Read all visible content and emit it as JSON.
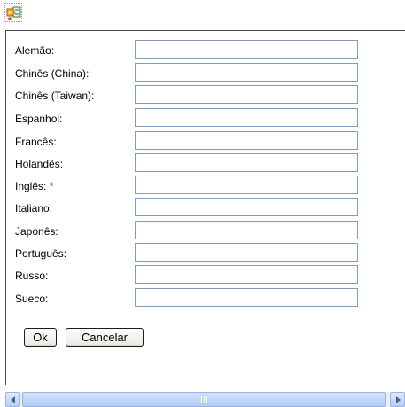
{
  "toolbar": {
    "translate_icon": "translate-icon"
  },
  "form": {
    "fields": [
      {
        "label": "Alemão:",
        "value": ""
      },
      {
        "label": "Chinês (China):",
        "value": ""
      },
      {
        "label": "Chinês (Taiwan):",
        "value": ""
      },
      {
        "label": "Espanhol:",
        "value": ""
      },
      {
        "label": "Francês:",
        "value": ""
      },
      {
        "label": "Holandês:",
        "value": ""
      },
      {
        "label": "Inglês: *",
        "value": ""
      },
      {
        "label": "Italiano:",
        "value": ""
      },
      {
        "label": "Japonês:",
        "value": ""
      },
      {
        "label": "Português:",
        "value": ""
      },
      {
        "label": "Russo:",
        "value": ""
      },
      {
        "label": "Sueco:",
        "value": ""
      }
    ],
    "ok_label": "Ok",
    "cancel_label": "Cancelar"
  },
  "scrollbar": {
    "left_icon": "arrow-left-icon",
    "right_icon": "arrow-right-icon"
  },
  "colors": {
    "input_border": "#7f9db9",
    "scrollbar": "#b9cff7"
  }
}
